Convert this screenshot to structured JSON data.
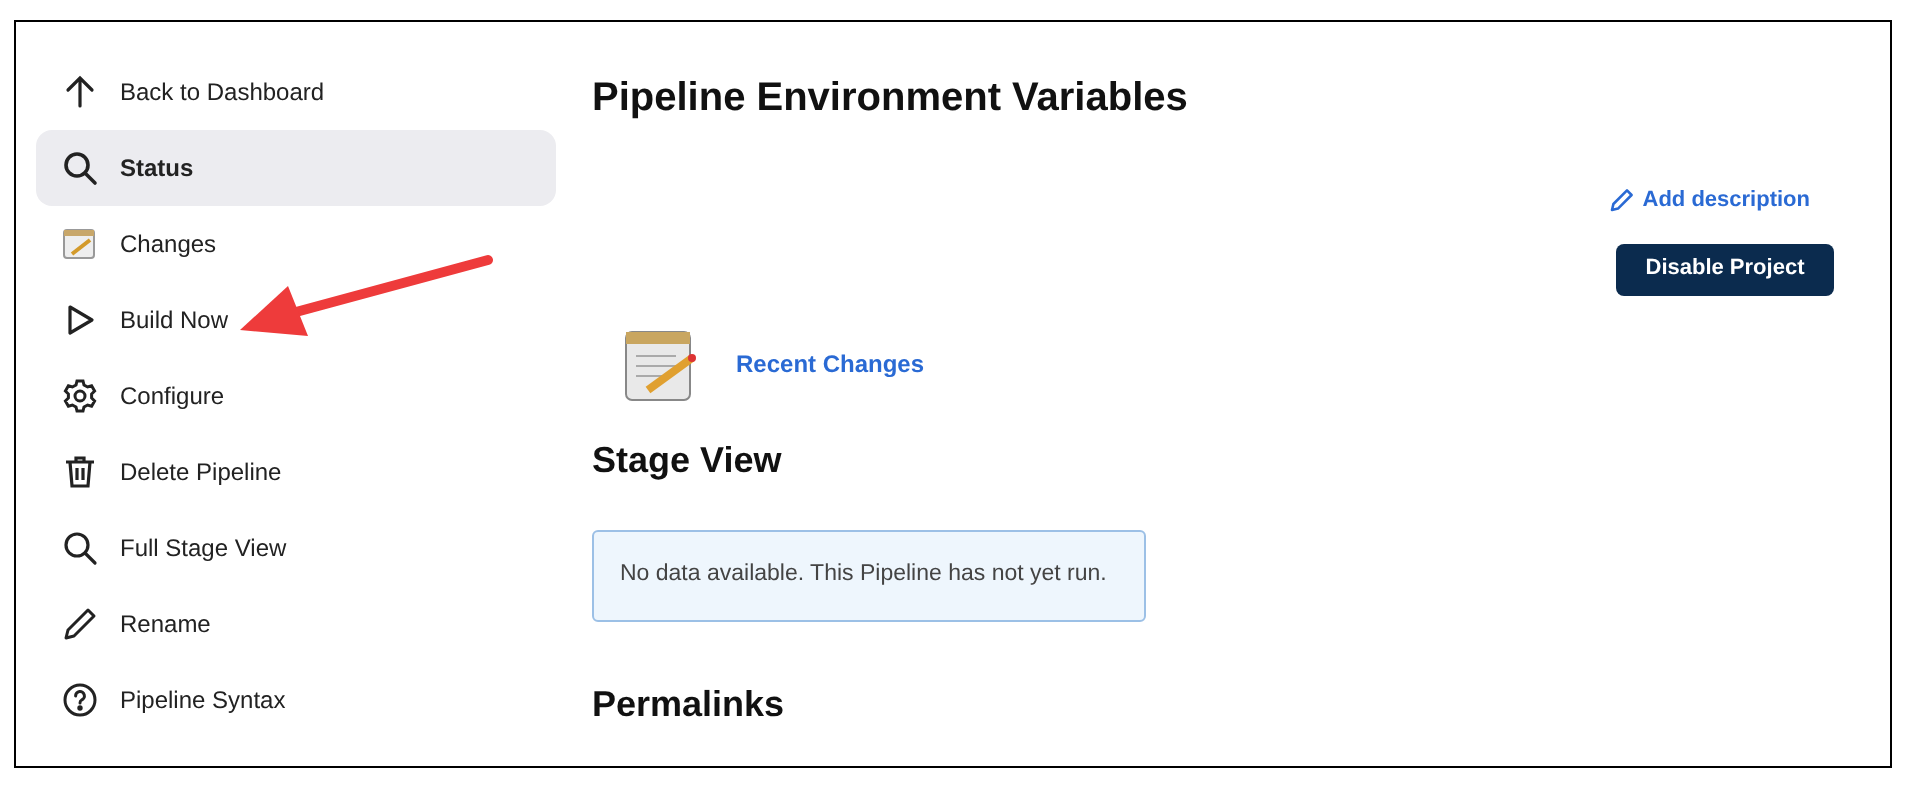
{
  "sidebar": {
    "items": [
      {
        "label": "Back to Dashboard",
        "selected": false
      },
      {
        "label": "Status",
        "selected": true
      },
      {
        "label": "Changes",
        "selected": false
      },
      {
        "label": "Build Now",
        "selected": false
      },
      {
        "label": "Configure",
        "selected": false
      },
      {
        "label": "Delete Pipeline",
        "selected": false
      },
      {
        "label": "Full Stage View",
        "selected": false
      },
      {
        "label": "Rename",
        "selected": false
      },
      {
        "label": "Pipeline Syntax",
        "selected": false
      }
    ]
  },
  "main": {
    "title": "Pipeline Environment Variables",
    "add_description": "Add description",
    "disable_button": "Disable Project",
    "recent_changes": "Recent Changes",
    "stage_view": {
      "heading": "Stage View",
      "message": "No data available. This Pipeline has not yet run."
    },
    "permalinks": {
      "heading": "Permalinks"
    }
  }
}
